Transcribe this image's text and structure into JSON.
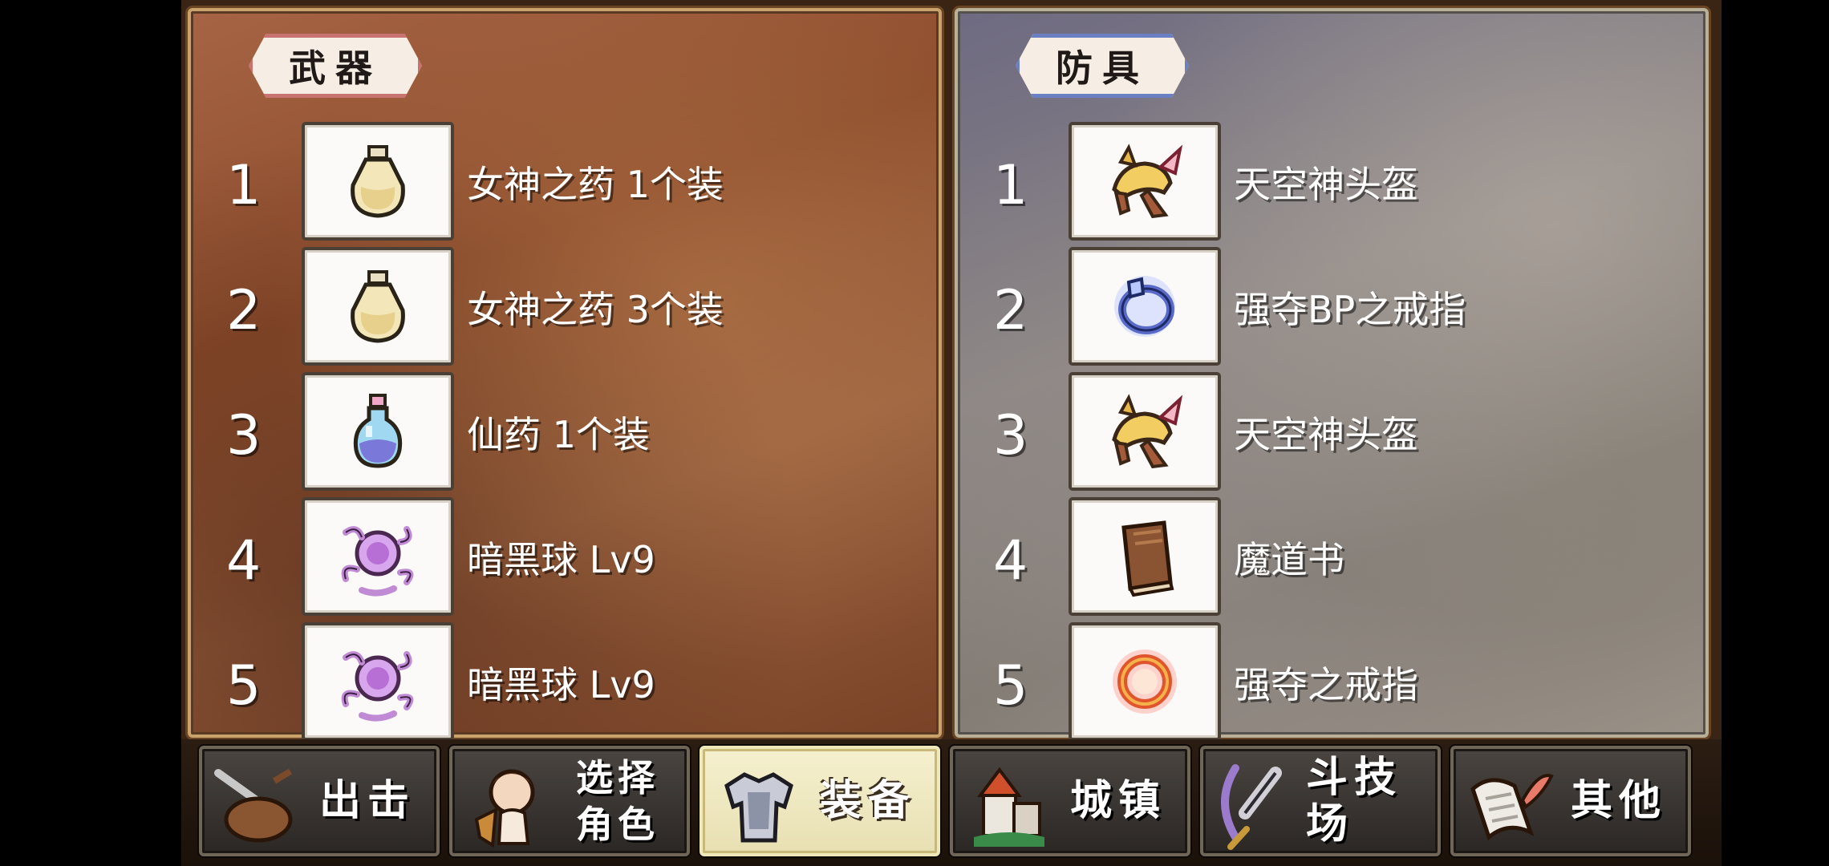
{
  "weapons_panel": {
    "title": "武器",
    "items": [
      {
        "index": "1",
        "name": "女神之药 1个装",
        "icon": "potion-bottle-icon"
      },
      {
        "index": "2",
        "name": "女神之药 3个装",
        "icon": "potion-bottle-icon"
      },
      {
        "index": "3",
        "name": "仙药 1个装",
        "icon": "elixir-icon"
      },
      {
        "index": "4",
        "name": "暗黑球 Lv9",
        "icon": "dark-orb-icon"
      },
      {
        "index": "5",
        "name": "暗黑球 Lv9",
        "icon": "dark-orb-icon"
      }
    ]
  },
  "armor_panel": {
    "title": "防具",
    "items": [
      {
        "index": "1",
        "name": "天空神头盔",
        "icon": "winged-helmet-icon"
      },
      {
        "index": "2",
        "name": "强夺BP之戒指",
        "icon": "blue-ring-icon"
      },
      {
        "index": "3",
        "name": "天空神头盔",
        "icon": "winged-helmet-icon"
      },
      {
        "index": "4",
        "name": "魔道书",
        "icon": "spellbook-icon"
      },
      {
        "index": "5",
        "name": "强夺之戒指",
        "icon": "red-ring-icon"
      }
    ]
  },
  "nav": {
    "sortie": "出击",
    "select_line1": "选择",
    "select_line2": "角色",
    "equip": "装备",
    "town": "城镇",
    "arena": "斗技场",
    "other": "其他",
    "active": "equip"
  },
  "colors": {
    "weapons_accent": "#c87370",
    "armor_accent": "#6b7fc3",
    "active_tab": "#f5f0cf"
  }
}
